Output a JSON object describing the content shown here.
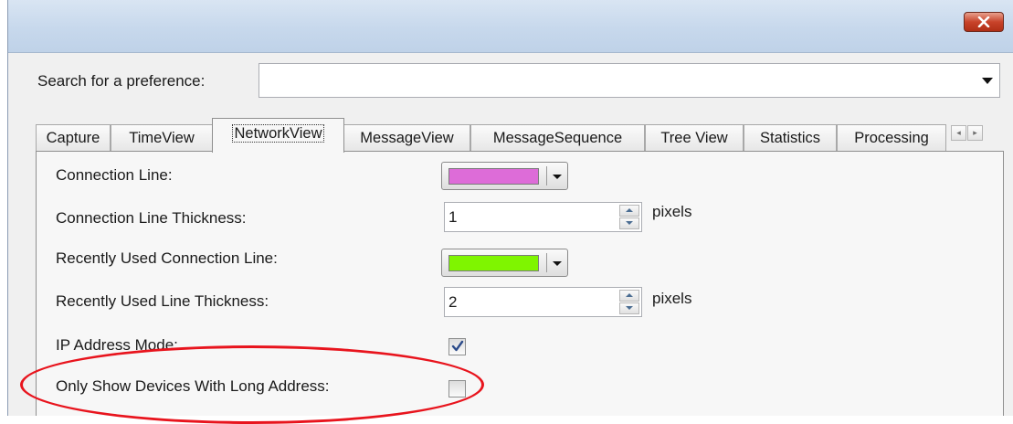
{
  "window": {
    "close_icon": "close-icon",
    "close_color": "#c8432a"
  },
  "search": {
    "label": "Search for a preference:",
    "value": "",
    "placeholder": ""
  },
  "tabs": [
    {
      "label": "Capture",
      "active": false
    },
    {
      "label": "TimeView",
      "active": false
    },
    {
      "label": "NetworkView",
      "active": true
    },
    {
      "label": "MessageView",
      "active": false
    },
    {
      "label": "MessageSequence",
      "active": false
    },
    {
      "label": "Tree View",
      "active": false
    },
    {
      "label": "Statistics",
      "active": false
    },
    {
      "label": "Processing",
      "active": false
    }
  ],
  "tab_scroll": {
    "left_glyph": "◂",
    "right_glyph": "▸"
  },
  "settings": {
    "connection_line": {
      "label": "Connection Line:",
      "color": "#dd6cd8"
    },
    "connection_line_thickness": {
      "label": "Connection Line Thickness:",
      "value": "1",
      "unit": "pixels"
    },
    "recent_connection_line": {
      "label": "Recently Used Connection Line:",
      "color": "#7ff500"
    },
    "recent_line_thickness": {
      "label": "Recently Used Line Thickness:",
      "value": "2",
      "unit": "pixels"
    },
    "ip_address_mode": {
      "label": "IP Address Mode:",
      "checked": true
    },
    "long_address": {
      "label": "Only Show Devices With Long Address:",
      "checked": false
    }
  },
  "annotation": {
    "color": "#e8141d"
  }
}
